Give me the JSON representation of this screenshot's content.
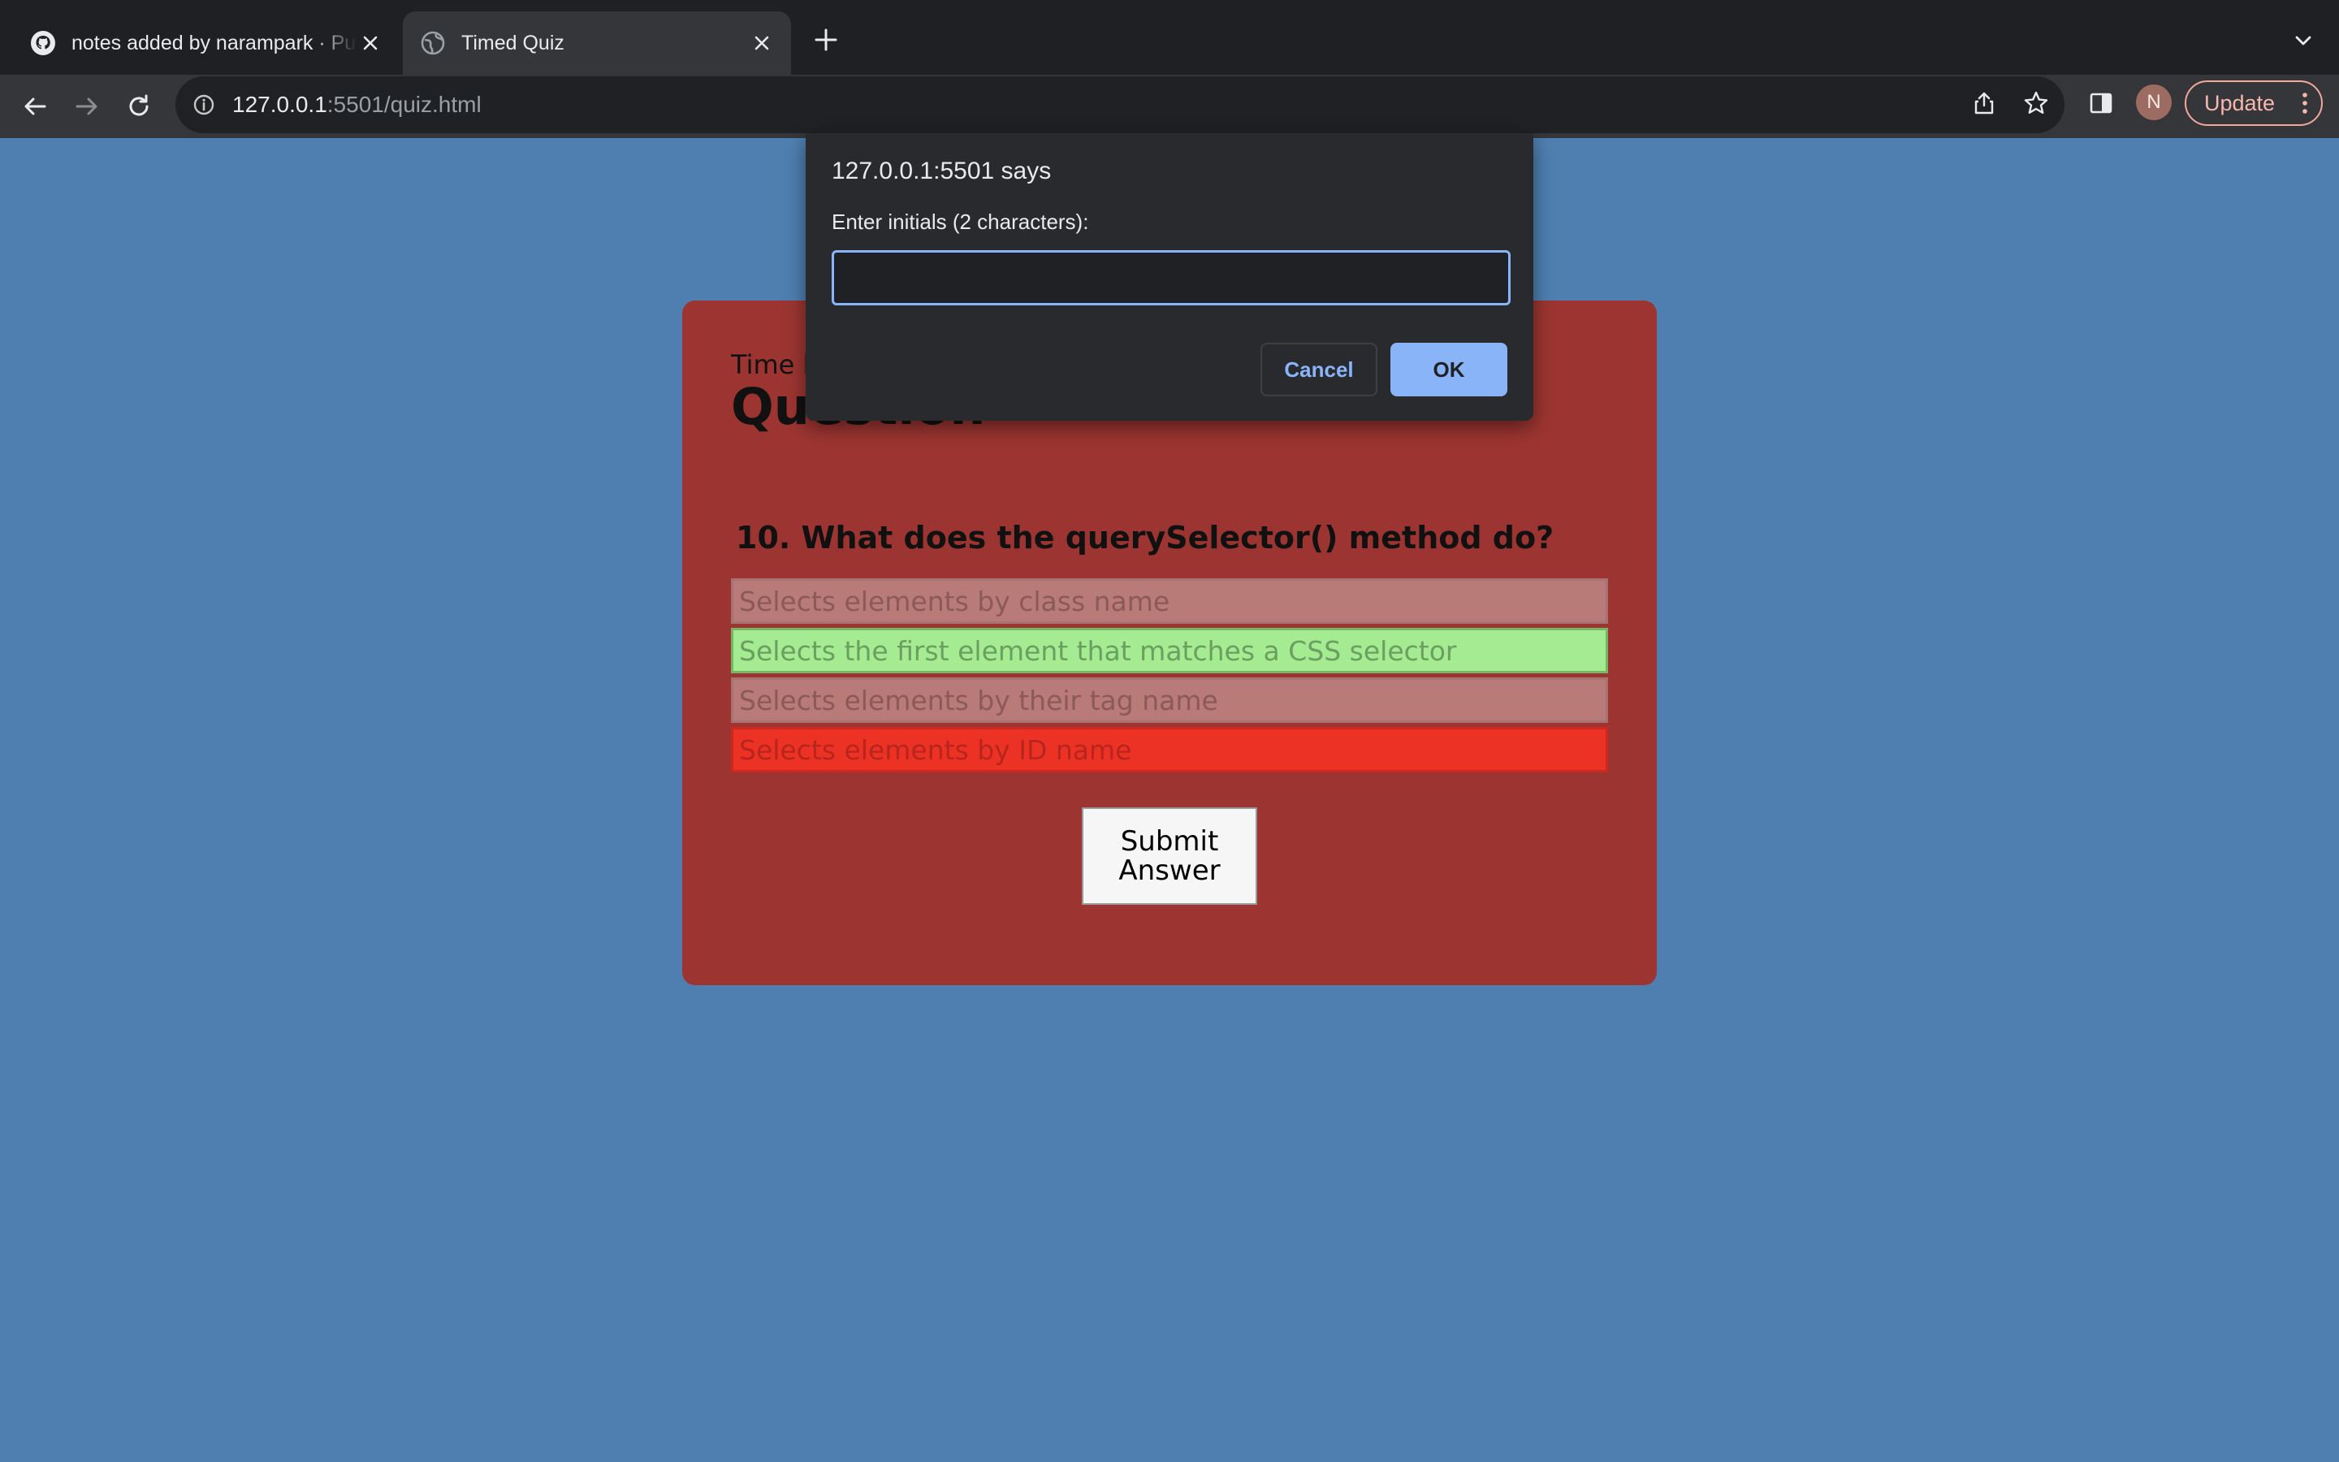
{
  "browser": {
    "tabs": [
      {
        "title": "notes added by narampark · Pu",
        "icon": "github-icon",
        "active": false
      },
      {
        "title": "Timed Quiz",
        "icon": "globe-icon",
        "active": true
      }
    ],
    "address": {
      "host": "127.0.0.1",
      "rest": ":5501/quiz.html"
    },
    "profile_initial": "N",
    "update_label": "Update",
    "colors": {
      "tabstrip": "#1f2023",
      "toolbar": "#35363a",
      "update_accent": "#f2a89a"
    }
  },
  "dialog": {
    "title": "127.0.0.1:5501 says",
    "message": "Enter initials (2 characters):",
    "input_value": "",
    "cancel_label": "Cancel",
    "ok_label": "OK",
    "colors": {
      "accent": "#8ab4f8",
      "background": "#292a2d"
    }
  },
  "quiz": {
    "time_label": "Time l",
    "heading": "Question",
    "question": "10. What does the querySelector() method do?",
    "answers": [
      {
        "text": "Selects elements by class name",
        "state": "neutral"
      },
      {
        "text": "Selects the first element that matches a CSS selector",
        "state": "correct"
      },
      {
        "text": "Selects elements by their tag name",
        "state": "neutral"
      },
      {
        "text": "Selects elements by ID name",
        "state": "wrong"
      }
    ],
    "submit_label": "Submit Answer",
    "colors": {
      "page_background": "#4f7fb1",
      "card": "#9c3531",
      "correct": "#a5eb92",
      "wrong": "#ec3225",
      "neutral": "#b97b78"
    }
  }
}
